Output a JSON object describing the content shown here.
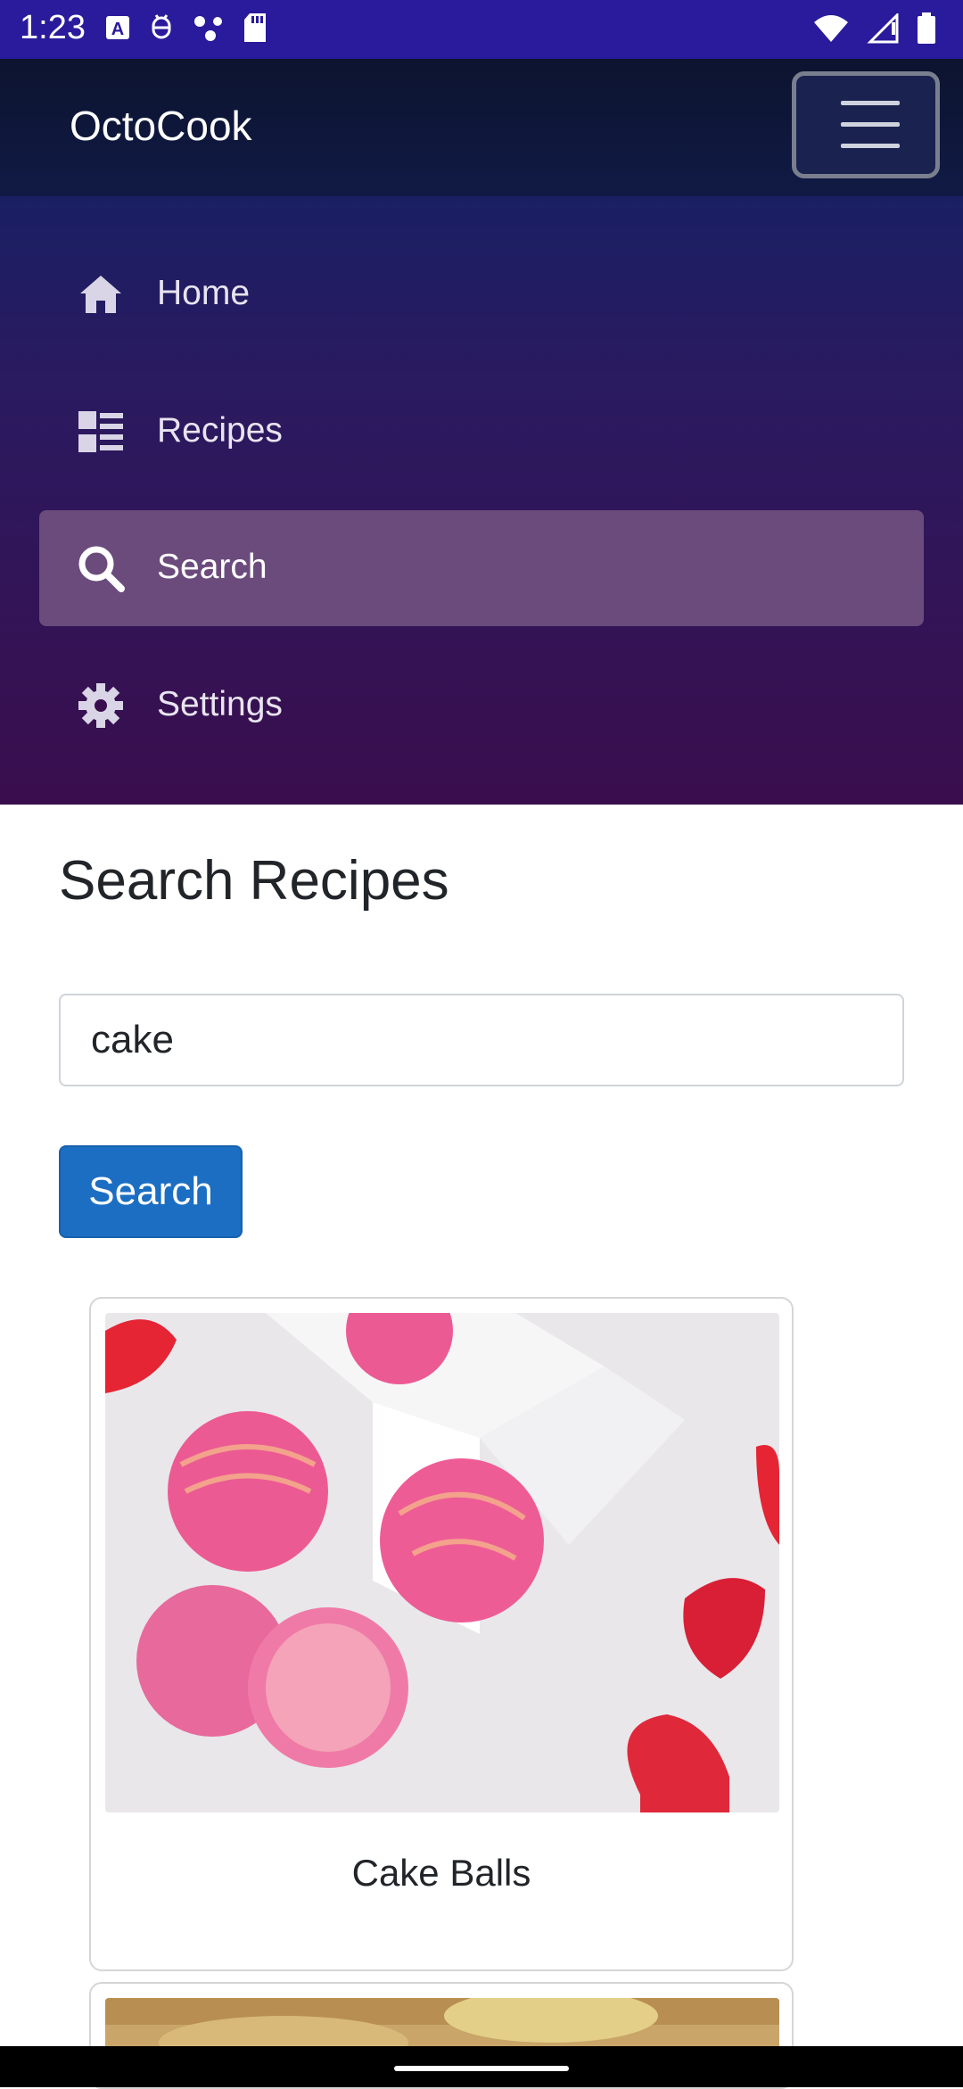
{
  "status_bar": {
    "time": "1:23"
  },
  "header": {
    "brand": "OctoCook"
  },
  "nav": {
    "items": [
      {
        "label": "Home",
        "icon": "home-icon"
      },
      {
        "label": "Recipes",
        "icon": "list-icon"
      },
      {
        "label": "Search",
        "icon": "search-icon",
        "active": true
      },
      {
        "label": "Settings",
        "icon": "gear-icon"
      }
    ]
  },
  "main": {
    "title": "Search Recipes",
    "search_value": "cake",
    "search_button": "Search",
    "results": [
      {
        "title": "Cake Balls"
      }
    ]
  },
  "colors": {
    "status_bar": "#2a1a9c",
    "accent_button": "#1b6ec2",
    "active_nav": "#6b4b7c"
  }
}
